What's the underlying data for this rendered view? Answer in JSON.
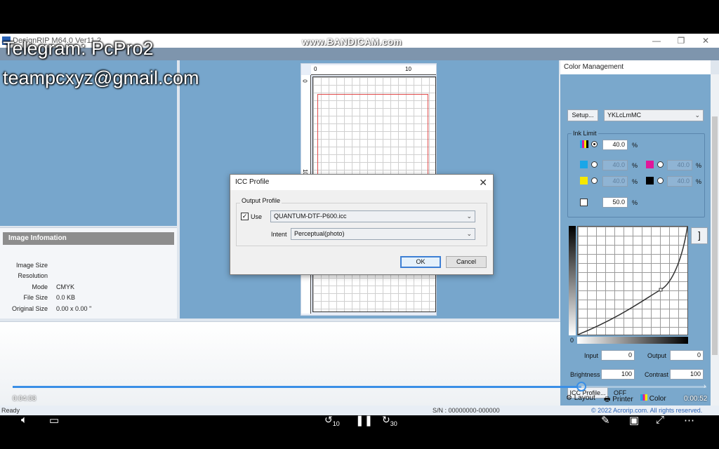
{
  "app": {
    "title": "DesignRIP M64.0 Ver11.2",
    "status": "Ready",
    "serial": "S/N : 00000000-000000",
    "copyright": "© 2022 Acrorip.com. All rights reserved."
  },
  "overlay": {
    "telegram": "Telegram: PcPro2",
    "email": "teampcxyz@gmail.com",
    "watermark": "www.BANDICAM.com"
  },
  "image_info": {
    "header": "Image Infomation",
    "rows": [
      {
        "key": "Image Size",
        "value": ""
      },
      {
        "key": "Resolution",
        "value": ""
      },
      {
        "key": "Mode",
        "value": "CMYK"
      },
      {
        "key": "File Size",
        "value": "0.0 KB"
      },
      {
        "key": "Original Size",
        "value": "0.00 x 0.00 ''"
      }
    ]
  },
  "ruler": {
    "top_start": "0",
    "top_ten": "10",
    "left_start": "0",
    "left_ten": "10"
  },
  "color_management": {
    "title": "Color Management",
    "setup_label": "Setup...",
    "channel_mode": "YKLcLmMC",
    "ink_limit_label": "Ink Limit",
    "total_value": "40.0",
    "cyan_value": "40.0",
    "magenta_value": "40.0",
    "yellow_value": "40.0",
    "black_value": "40.0",
    "white_value": "50.0",
    "percent": "%",
    "curve_origin": "0",
    "input_label": "Input",
    "input_value": "0",
    "output_label": "Output",
    "output_value": "0",
    "brightness_label": "Brightness",
    "brightness_value": "100",
    "contrast_label": "Contrast",
    "contrast_value": "100",
    "icc_button": "ICC Profile...",
    "icc_state": "OFF"
  },
  "tabs": [
    {
      "label": "Layout",
      "icon": "layout-icon"
    },
    {
      "label": "Printer",
      "icon": "printer-icon"
    },
    {
      "label": "Color",
      "icon": "color-icon"
    }
  ],
  "dialog": {
    "title": "ICC Profile",
    "group_label": "Output Profile",
    "use_label": "Use",
    "use_checked": true,
    "profile": "QUANTUM-DTF-P600.icc",
    "intent_label": "Intent",
    "intent": "Perceptual(photo)",
    "ok_label": "OK",
    "cancel_label": "Cancel"
  },
  "video": {
    "current_time": "0:04:08",
    "remaining_time": "0:00:52",
    "progress": 0.82,
    "rewind_label": "10",
    "forward_label": "30"
  },
  "colors": {
    "panel_blue": "#77a6cc",
    "accent": "#3a8fe6",
    "cyan": "#1aa6e8",
    "magenta": "#e0179a",
    "yellow": "#f5e800",
    "black": "#000000"
  }
}
